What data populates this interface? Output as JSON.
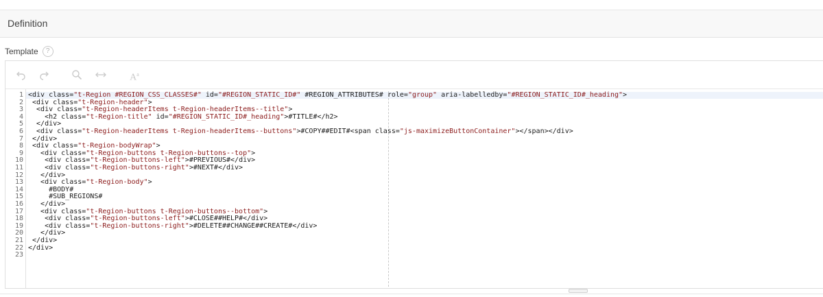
{
  "section": {
    "title": "Definition"
  },
  "field": {
    "label": "Template",
    "help_symbol": "?"
  },
  "toolbar": {
    "icons": [
      "undo-icon",
      "redo-icon",
      "search-icon",
      "replace-icon",
      "font-size-icon"
    ],
    "font_label": "A"
  },
  "editor": {
    "line_numbers": [
      "1",
      "2",
      "3",
      "4",
      "5",
      "6",
      "7",
      "8",
      "9",
      "10",
      "11",
      "12",
      "13",
      "14",
      "15",
      "16",
      "17",
      "18",
      "19",
      "20",
      "21",
      "22",
      "23"
    ],
    "lines": [
      "<div class=\"t-Region #REGION_CSS_CLASSES#\" id=\"#REGION_STATIC_ID#\" #REGION_ATTRIBUTES# role=\"group\" aria-labelledby=\"#REGION_STATIC_ID#_heading\">",
      " <div class=\"t-Region-header\">",
      "  <div class=\"t-Region-headerItems t-Region-headerItems--title\">",
      "    <h2 class=\"t-Region-title\" id=\"#REGION_STATIC_ID#_heading\">#TITLE#</h2>",
      "  </div>",
      "  <div class=\"t-Region-headerItems t-Region-headerItems--buttons\">#COPY##EDIT#<span class=\"js-maximizeButtonContainer\"></span></div>",
      " </div>",
      " <div class=\"t-Region-bodyWrap\">",
      "   <div class=\"t-Region-buttons t-Region-buttons--top\">",
      "    <div class=\"t-Region-buttons-left\">#PREVIOUS#</div>",
      "    <div class=\"t-Region-buttons-right\">#NEXT#</div>",
      "   </div>",
      "   <div class=\"t-Region-body\">",
      "     #BODY#",
      "     #SUB_REGIONS#",
      "   </div>",
      "   <div class=\"t-Region-buttons t-Region-buttons--bottom\">",
      "    <div class=\"t-Region-buttons-left\">#CLOSE##HELP#</div>",
      "    <div class=\"t-Region-buttons-right\">#DELETE##CHANGE##CREATE#</div>",
      "   </div>",
      " </div>",
      "</div>",
      ""
    ]
  },
  "colors": {
    "string": "#8b1a1a",
    "text": "#1a1a1a",
    "line_number": "#6b6b6b",
    "active_line": "#eef3fb",
    "toolbar_icon": "#c9c9c9"
  }
}
